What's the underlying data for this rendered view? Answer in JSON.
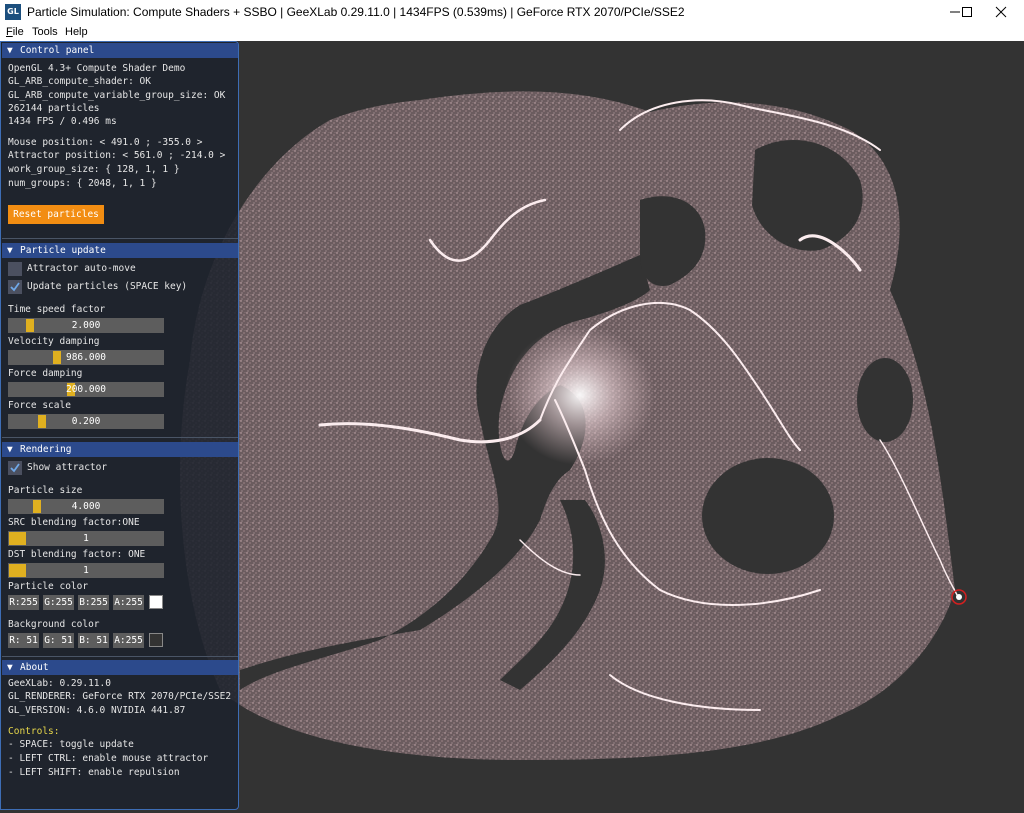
{
  "window": {
    "app_icon": "GL",
    "title": "Particle Simulation: Compute Shaders + SSBO | GeeXLab 0.29.11.0 | 1434FPS (0.539ms) | GeForce RTX 2070/PCIe/SSE2",
    "controls": [
      "minimize-icon",
      "maximize-icon",
      "close-icon"
    ]
  },
  "menu": [
    {
      "first": "F",
      "rest": "ile"
    },
    {
      "first": "",
      "rest": "Tools"
    },
    {
      "first": "",
      "rest": "Help"
    }
  ],
  "panel": {
    "title": "Control panel",
    "info": [
      "OpenGL 4.3+ Compute Shader Demo",
      "GL_ARB_compute_shader: OK",
      "GL_ARB_compute_variable_group_size: OK",
      "262144 particles",
      "1434 FPS / 0.496 ms"
    ],
    "state": [
      "Mouse position: < 491.0 ; -355.0 >",
      "Attractor position: < 561.0 ; -214.0 >",
      "work_group_size: { 128, 1, 1 }",
      "num_groups: { 2048, 1, 1 }"
    ],
    "reset_button": "Reset particles",
    "accent": "#f28d12"
  },
  "particle_update": {
    "title": "Particle update",
    "attractor_auto_move": {
      "label": "Attractor auto-move",
      "checked": false
    },
    "update_particles": {
      "label": "Update particles (SPACE key)",
      "checked": true
    },
    "time_speed": {
      "label": "Time speed factor",
      "value": "2.000"
    },
    "velocity_damping": {
      "label": "Velocity damping",
      "value": "986.000"
    },
    "force_damping": {
      "label": "Force damping",
      "value": "200.000"
    },
    "force_scale": {
      "label": "Force scale",
      "value": "0.200"
    }
  },
  "rendering": {
    "title": "Rendering",
    "show_attractor": {
      "label": "Show attractor",
      "checked": true
    },
    "particle_size": {
      "label": "Particle size",
      "value": "4.000"
    },
    "src_blend": {
      "label": "SRC blending factor:ONE",
      "value": "1"
    },
    "dst_blend": {
      "label": "DST blending factor: ONE",
      "value": "1"
    },
    "particle_color": {
      "label": "Particle color",
      "r": "R:255",
      "g": "G:255",
      "b": "B:255",
      "a": "A:255",
      "swatch": "#ffffff"
    },
    "background_color": {
      "label": "Background color",
      "r": "R: 51",
      "g": "G: 51",
      "b": "B: 51",
      "a": "A:255",
      "swatch": "#333333"
    }
  },
  "about": {
    "title": "About",
    "lines": [
      "GeeXLab: 0.29.11.0",
      "GL_RENDERER: GeForce RTX 2070/PCIe/SSE2",
      "GL_VERSION: 4.6.0 NVIDIA 441.87"
    ],
    "controls_title": "Controls:",
    "controls": [
      "- SPACE: toggle update",
      "- LEFT CTRL: enable mouse attractor",
      "- LEFT SHIFT: enable repulsion"
    ]
  },
  "colors": {
    "particles": "#e8c8cc",
    "background": "#333333",
    "attractor_ring": "#d42020",
    "header": "#2c4a8c",
    "slider_grab": "#e0b020"
  }
}
